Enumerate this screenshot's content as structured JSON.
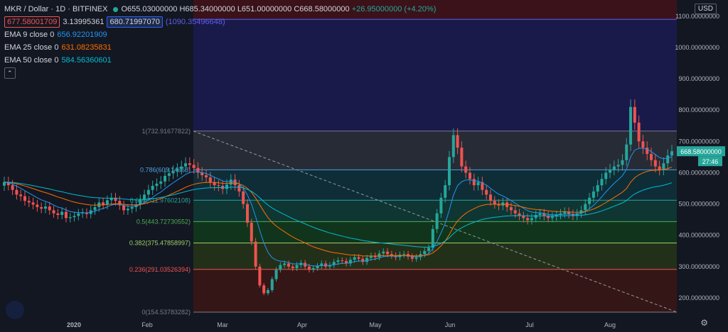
{
  "header": {
    "symbol": "MKR / Dollar · 1D · BITFINEX",
    "open": "O655.03000000",
    "high": "H685.34000000",
    "low": "L651.00000000",
    "close": "C668.58000000",
    "change": "+26.95000000 (+4.20%)",
    "sell_price": "677.58001709",
    "spread": "3.13995361",
    "buy_price": "680.71997070",
    "top_hidden_label": "(1090.35496648)"
  },
  "indicators": [
    {
      "label": "EMA 9 close 0",
      "value": "656.92201909",
      "color": "#2196f3"
    },
    {
      "label": "EMA 25 close 0",
      "value": "631.08235831",
      "color": "#ff6d00"
    },
    {
      "label": "EMA 50 close 0",
      "value": "584.56360601",
      "color": "#00bcd4"
    }
  ],
  "currency_button": "USD",
  "price_badge": "668.58000000",
  "countdown_badge": "27:46",
  "colors": {
    "up": "#26a69a",
    "down": "#ef5350",
    "background": "#131722"
  },
  "chart_data": {
    "type": "candlestick",
    "x_ticks": [
      "2020",
      "Feb",
      "Mar",
      "Apr",
      "May",
      "Jun",
      "Jul",
      "Aug"
    ],
    "y_ticks": [
      "1100.00000000",
      "1000.00000000",
      "900.00000000",
      "800.00000000",
      "700.00000000",
      "600.00000000",
      "500.00000000",
      "400.00000000",
      "300.00000000",
      "200.00000000"
    ],
    "ylim": [
      150,
      1120
    ],
    "fib_levels": [
      {
        "ratio": 1,
        "price": 732.91677822,
        "label": "1(732.91677822)",
        "color": "#787b86"
      },
      {
        "ratio": 0.786,
        "price": 609.14368,
        "label": "0.786(609.14368)",
        "color": "#4aa3df"
      },
      {
        "ratio": 0.618,
        "price": 511.97602108,
        "label": "0.618(511.97602108)",
        "color": "#26a69a"
      },
      {
        "ratio": 0.5,
        "price": 443.72730552,
        "label": "0.5(443.72730552)",
        "color": "#4caf50"
      },
      {
        "ratio": 0.382,
        "price": 375.47858997,
        "label": "0.382(375.47858997)",
        "color": "#9ccc65"
      },
      {
        "ratio": 0.236,
        "price": 291.03526394,
        "label": "0.236(291.03526394)",
        "color": "#ef5350"
      },
      {
        "ratio": 0,
        "price": 154.53783282,
        "label": "0(154.53783282)",
        "color": "#787b86"
      }
    ],
    "close_prices": [
      570,
      560,
      545,
      530,
      525,
      510,
      505,
      498,
      490,
      485,
      492,
      480,
      470,
      465,
      475,
      455,
      458,
      462,
      470,
      472,
      468,
      480,
      490,
      505,
      498,
      512,
      520,
      510,
      496,
      480,
      485,
      490,
      498,
      515,
      530,
      545,
      558,
      565,
      572,
      590,
      598,
      605,
      612,
      620,
      630,
      625,
      615,
      600,
      592,
      585,
      570,
      560,
      558,
      548,
      562,
      578,
      560,
      540,
      500,
      440,
      380,
      300,
      240,
      215,
      225,
      260,
      290,
      305,
      310,
      300,
      295,
      305,
      312,
      300,
      290,
      295,
      302,
      310,
      300,
      305,
      315,
      320,
      318,
      310,
      322,
      330,
      325,
      315,
      328,
      335,
      330,
      342,
      348,
      340,
      335,
      330,
      338,
      340,
      332,
      325,
      330,
      340,
      350,
      360,
      420,
      470,
      520,
      560,
      650,
      720,
      680,
      620,
      600,
      580,
      560,
      570,
      545,
      530,
      510,
      500,
      495,
      505,
      490,
      480,
      470,
      462,
      455,
      448,
      455,
      465,
      470,
      462,
      455,
      460,
      465,
      470,
      475,
      468,
      462,
      470,
      480,
      500,
      520,
      540,
      560,
      580,
      600,
      610,
      620,
      625,
      640,
      690,
      810,
      760,
      700,
      680,
      660,
      640,
      620,
      610,
      630,
      655,
      668.58
    ]
  }
}
